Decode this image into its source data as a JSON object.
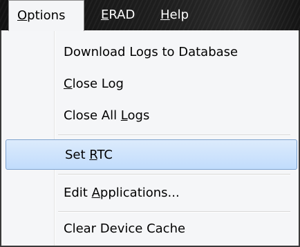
{
  "menubar": {
    "items": [
      {
        "pre": "",
        "key": "O",
        "post": "ptions"
      },
      {
        "pre": "",
        "key": "E",
        "post": "RAD"
      },
      {
        "pre": "",
        "key": "H",
        "post": "elp"
      }
    ]
  },
  "dropdown": {
    "items": [
      {
        "pre": "Download Logs to Database",
        "key": "",
        "post": ""
      },
      {
        "pre": "",
        "key": "C",
        "post": "lose Log"
      },
      {
        "pre": "Close All ",
        "key": "L",
        "post": "ogs"
      },
      {
        "pre": "Set ",
        "key": "R",
        "post": "TC"
      },
      {
        "pre": "Edit ",
        "key": "A",
        "post": "pplications..."
      },
      {
        "pre": "Clear Device Cache",
        "key": "",
        "post": ""
      }
    ]
  }
}
